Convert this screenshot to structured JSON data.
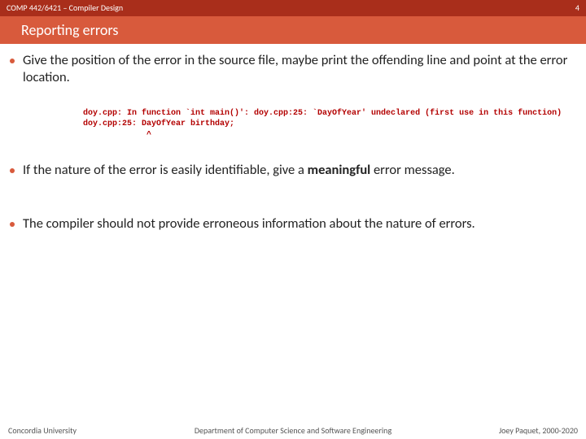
{
  "header": {
    "course": "COMP 442/6421 – Compiler Design",
    "page": "4"
  },
  "title": "Reporting errors",
  "bullets": {
    "b1": "Give the position of the error in the source file, maybe print the offending line and point at the error location.",
    "b2_pre": "If the nature of the error is easily identifiable, give a ",
    "b2_bold": "meaningful",
    "b2_post": " error message.",
    "b3": "The compiler should not provide erroneous information about the nature of errors."
  },
  "code": "doy.cpp: In function `int main()': doy.cpp:25: `DayOfYear' undeclared (first use in this function)\ndoy.cpp:25: DayOfYear birthday;\n             ^",
  "footer": {
    "left": "Concordia University",
    "mid": "Department of Computer Science and Software Engineering",
    "right": "Joey Paquet, 2000-2020"
  }
}
